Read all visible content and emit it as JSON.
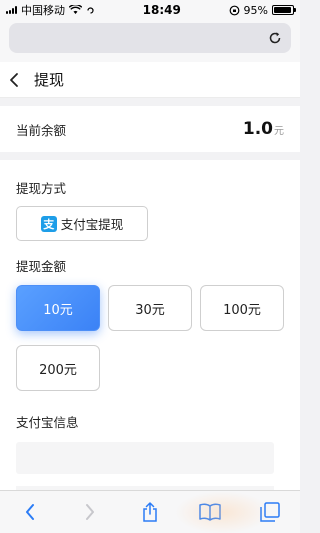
{
  "status_bar": {
    "carrier": "中国移动",
    "time": "18:49",
    "battery": "95%",
    "battery_level": 0.95
  },
  "header": {
    "title": "提现"
  },
  "balance": {
    "label": "当前余额",
    "amount": "1.0",
    "unit": "元"
  },
  "withdraw_method": {
    "label": "提现方式",
    "option_icon_char": "支",
    "option": "支付宝提现"
  },
  "withdraw_amount": {
    "label": "提现金额",
    "options": [
      {
        "label": "10元",
        "selected": true
      },
      {
        "label": "30元",
        "selected": false
      },
      {
        "label": "100元",
        "selected": false
      },
      {
        "label": "200元",
        "selected": false
      }
    ]
  },
  "alipay_info": {
    "label": "支付宝信息"
  },
  "colors": {
    "accent": "#3b82f6",
    "alipay_blue": "#1e9ee8"
  },
  "icons": {
    "back": "chevron-left-icon",
    "reload": "reload-icon",
    "share": "share-icon",
    "bookmarks": "book-icon",
    "tabs": "tabs-icon",
    "forward": "chevron-right-icon"
  }
}
